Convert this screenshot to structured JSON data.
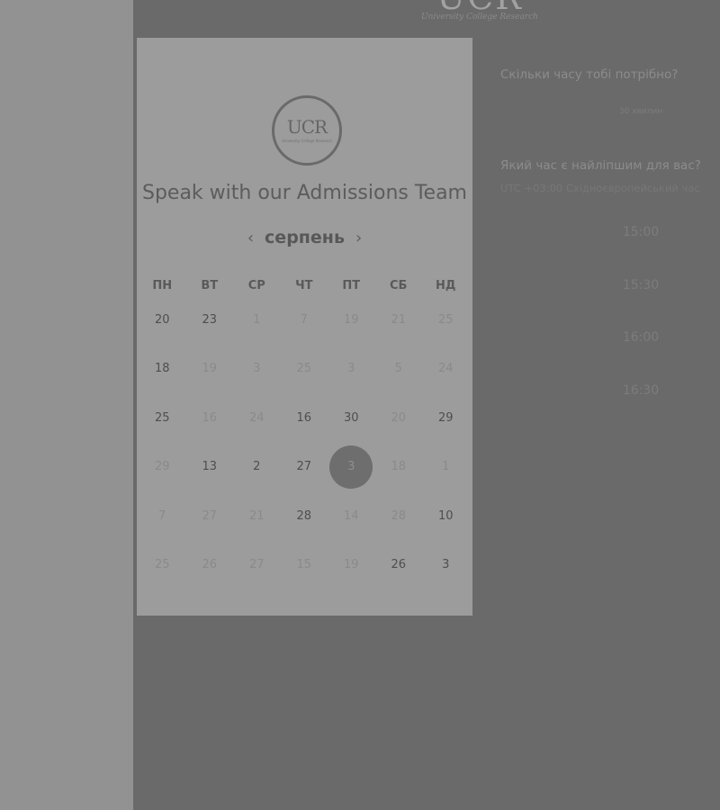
{
  "top_logo": {
    "text": "UCR",
    "tagline": "University College Research"
  },
  "card": {
    "logo_text": "UCR",
    "logo_sub": "University College Research",
    "title": "Speak with our Admissions Team",
    "month": "серпень",
    "prev_arrow": "‹",
    "next_arrow": "›",
    "weekdays": [
      "ПН",
      "ВТ",
      "СР",
      "ЧТ",
      "ПТ",
      "СБ",
      "НД"
    ],
    "days": [
      {
        "d": "20",
        "s": "active"
      },
      {
        "d": "23",
        "s": "active"
      },
      {
        "d": "1",
        "s": "dim"
      },
      {
        "d": "7",
        "s": "dim"
      },
      {
        "d": "19",
        "s": "dim"
      },
      {
        "d": "21",
        "s": "dim"
      },
      {
        "d": "25",
        "s": "dim"
      },
      {
        "d": "18",
        "s": "active"
      },
      {
        "d": "19",
        "s": "dim"
      },
      {
        "d": "3",
        "s": "dim"
      },
      {
        "d": "25",
        "s": "dim"
      },
      {
        "d": "3",
        "s": "dim"
      },
      {
        "d": "5",
        "s": "dim"
      },
      {
        "d": "24",
        "s": "dim"
      },
      {
        "d": "25",
        "s": "active"
      },
      {
        "d": "16",
        "s": "dim"
      },
      {
        "d": "24",
        "s": "dim"
      },
      {
        "d": "16",
        "s": "active"
      },
      {
        "d": "30",
        "s": "active"
      },
      {
        "d": "20",
        "s": "dim"
      },
      {
        "d": "29",
        "s": "active"
      },
      {
        "d": "29",
        "s": "dim"
      },
      {
        "d": "13",
        "s": "active"
      },
      {
        "d": "2",
        "s": "active"
      },
      {
        "d": "27",
        "s": "active"
      },
      {
        "d": "3",
        "s": "selected"
      },
      {
        "d": "18",
        "s": "dim"
      },
      {
        "d": "1",
        "s": "dim"
      },
      {
        "d": "7",
        "s": "dim"
      },
      {
        "d": "27",
        "s": "dim"
      },
      {
        "d": "21",
        "s": "dim"
      },
      {
        "d": "28",
        "s": "active"
      },
      {
        "d": "14",
        "s": "dim"
      },
      {
        "d": "28",
        "s": "dim"
      },
      {
        "d": "10",
        "s": "active"
      },
      {
        "d": "25",
        "s": "dim"
      },
      {
        "d": "26",
        "s": "dim"
      },
      {
        "d": "27",
        "s": "dim"
      },
      {
        "d": "15",
        "s": "dim"
      },
      {
        "d": "19",
        "s": "dim"
      },
      {
        "d": "26",
        "s": "active"
      },
      {
        "d": "3",
        "s": "active"
      }
    ]
  },
  "right": {
    "duration_question": "Скільки часу тобі потрібно?",
    "duration_value": "30 хвилин",
    "time_question": "Який час є найліпшим для вас?",
    "timezone": "UTC +03:00 Східноєвропейський час",
    "slots": [
      "15:00",
      "15:30",
      "16:00",
      "16:30"
    ]
  }
}
